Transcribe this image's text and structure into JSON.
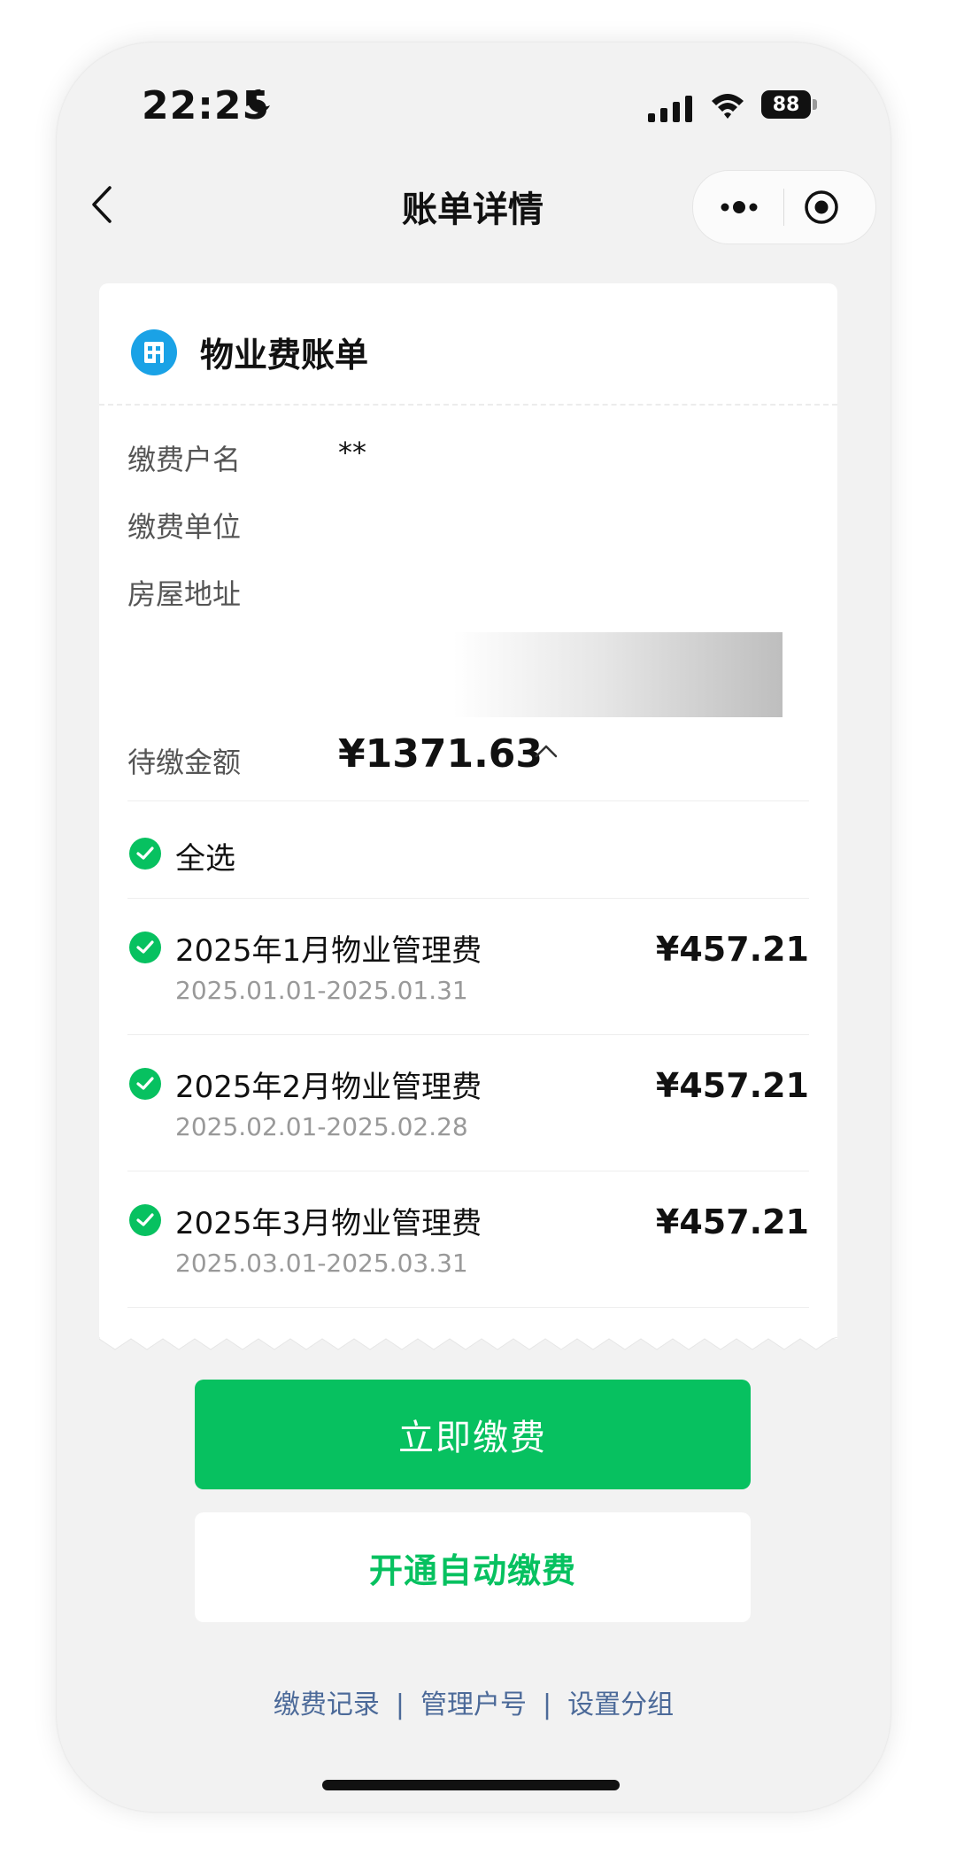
{
  "status_bar": {
    "time": "22:25",
    "battery": "88"
  },
  "nav": {
    "title": "账单详情"
  },
  "card": {
    "title": "物业费账单",
    "fields": [
      {
        "label": "缴费户名",
        "value": "**"
      },
      {
        "label": "缴费单位",
        "value": ""
      },
      {
        "label": "房屋地址",
        "value": ""
      }
    ],
    "due_label": "待缴金额",
    "due_amount": "¥1371.63",
    "select_all": "全选",
    "items": [
      {
        "title": "2025年1月物业管理费",
        "period": "2025.01.01-2025.01.31",
        "amount": "¥457.21"
      },
      {
        "title": "2025年2月物业管理费",
        "period": "2025.02.01-2025.02.28",
        "amount": "¥457.21"
      },
      {
        "title": "2025年3月物业管理费",
        "period": "2025.03.01-2025.03.31",
        "amount": "¥457.21"
      }
    ]
  },
  "actions": {
    "pay_now": "立即缴费",
    "auto_pay": "开通自动缴费"
  },
  "links": [
    "缴费记录",
    "管理户号",
    "设置分组"
  ],
  "colors": {
    "primary_green": "#07c160",
    "icon_blue": "#1aa2e6",
    "link_blue": "#4c6a99",
    "background": "#f2f2f2"
  }
}
